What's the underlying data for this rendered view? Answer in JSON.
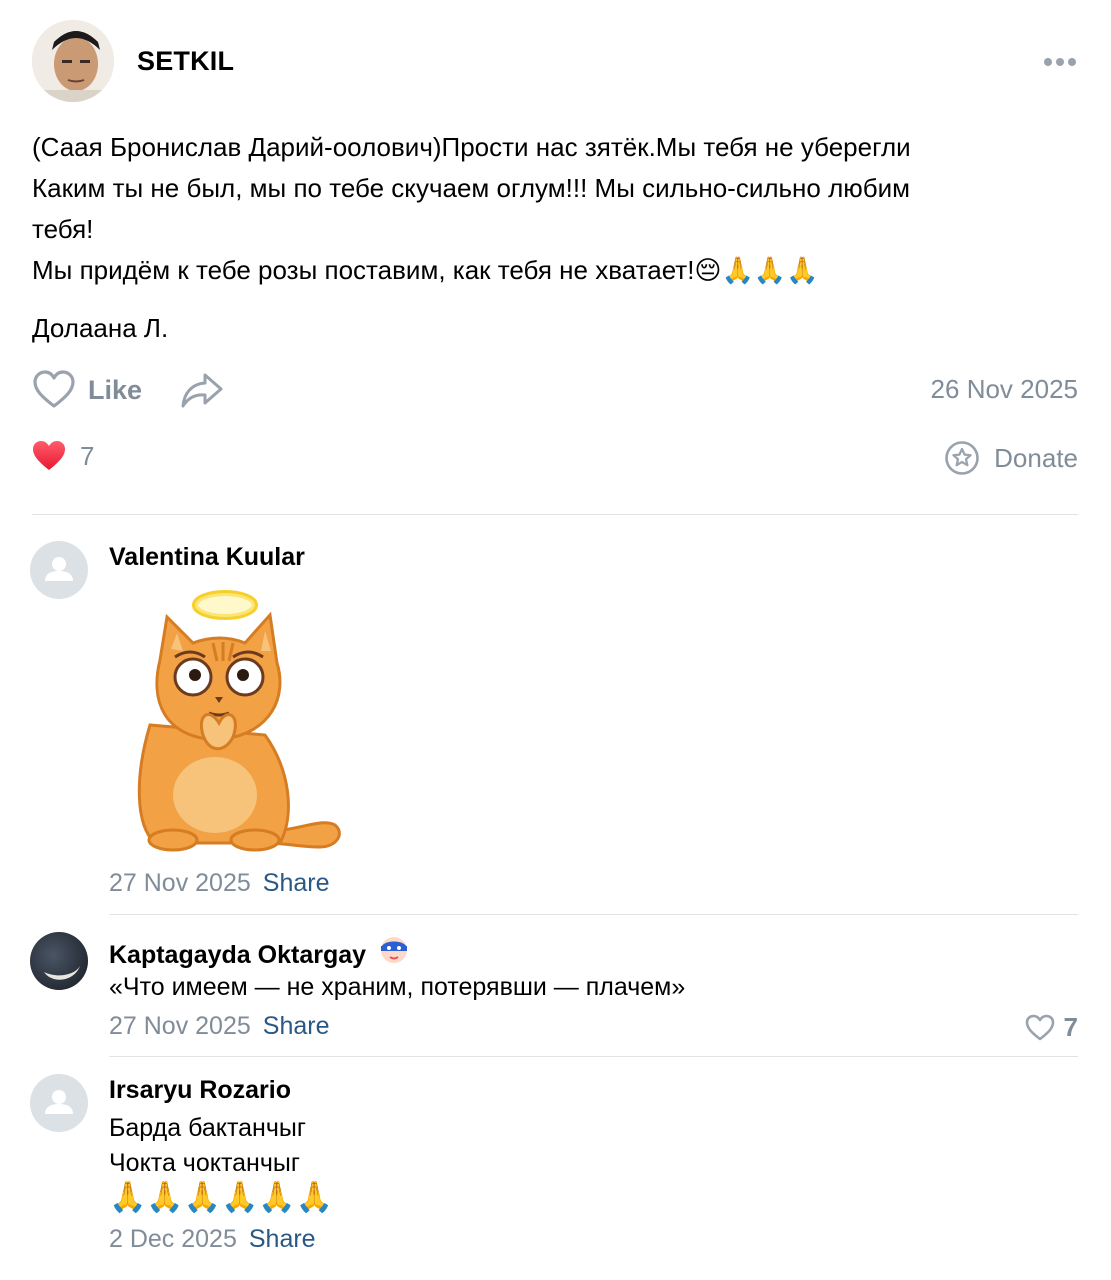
{
  "post": {
    "author": "SETKIL",
    "text_lines": [
      "(Саая Бронислав Дарий-оолович)Прости нас зятёк.Мы тебя не уберегли",
      "Каким ты не был, мы по тебе скучаем оглум!!! Мы сильно-сильно любим",
      "тебя!",
      "Мы придём к тебе розы поставим, как тебя не хватает!😔🙏🙏🙏"
    ],
    "signature": "Долаана Л.",
    "like_label": "Like",
    "date": "26 Nov 2025",
    "reactions_count": "7",
    "donate_label": "Donate"
  },
  "comments": [
    {
      "author": "Valentina Kuular",
      "date": "27 Nov 2025",
      "share_label": "Share"
    },
    {
      "author": "Kaptagayda Oktargay",
      "text": "«Что имеем — не храним, потерявши — плачем»",
      "date": "27 Nov 2025",
      "share_label": "Share",
      "likes": "7"
    },
    {
      "author": "Irsaryu Rozario",
      "text_lines": [
        "Барда бактанчыг",
        "Чокта чоктанчыг"
      ],
      "emojis": "🙏🙏🙏🙏🙏🙏",
      "date": "2 Dec 2025",
      "share_label": "Share"
    }
  ],
  "colors": {
    "muted": "#818c99",
    "link": "#2a5885",
    "divider": "#e1e3e6",
    "heart": "#ff3347"
  },
  "icons": {
    "more": "more-horizontal-icon",
    "like": "heart-outline-icon",
    "share": "share-arrow-icon",
    "reaction": "heart-filled-icon",
    "donate": "donate-star-icon"
  }
}
